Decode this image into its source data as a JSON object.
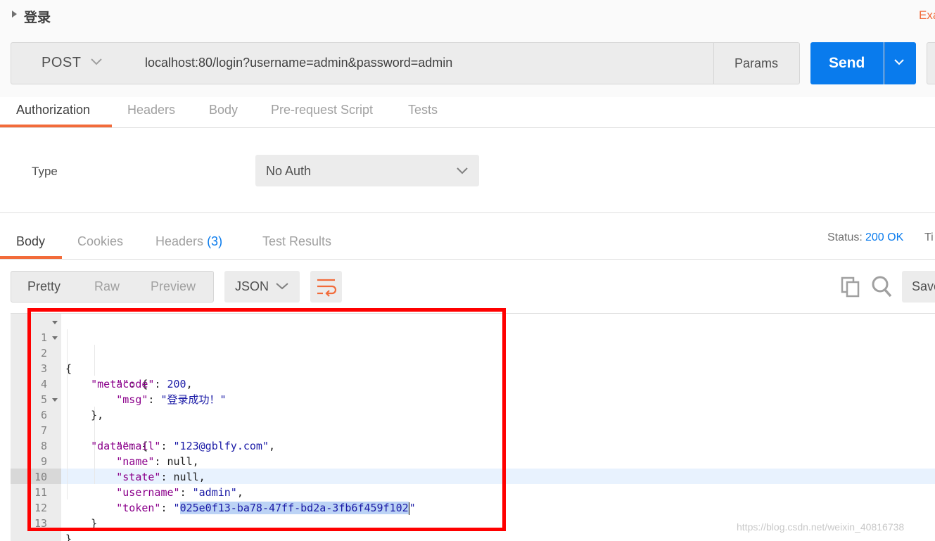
{
  "request": {
    "name": "登录",
    "examples_label": "Exa",
    "method": "POST",
    "url": "localhost:80/login?username=admin&password=admin",
    "params_label": "Params",
    "send_label": "Send"
  },
  "request_tabs": [
    "Authorization",
    "Headers",
    "Body",
    "Pre-request Script",
    "Tests"
  ],
  "auth": {
    "type_label": "Type",
    "type_value": "No Auth"
  },
  "response_tabs": {
    "body": "Body",
    "cookies": "Cookies",
    "headers": "Headers",
    "headers_count": "(3)",
    "test_results": "Test Results"
  },
  "status": {
    "label": "Status:",
    "value": "200 OK",
    "time_label": "Ti"
  },
  "view_options": [
    "Pretty",
    "Raw",
    "Preview"
  ],
  "format": "JSON",
  "save_label": "Save",
  "code": {
    "line_numbers": [
      "1",
      "2",
      "3",
      "4",
      "5",
      "6",
      "7",
      "8",
      "9",
      "10",
      "11",
      "12",
      "13"
    ],
    "meta_key": "\"meta\"",
    "code_key": "\"code\"",
    "code_value": "200",
    "msg_key": "\"msg\"",
    "msg_value": "\"登录成功！\"",
    "data_key": "\"data\"",
    "email_key": "\"email\"",
    "email_value": "\"123@gblfy.com\"",
    "name_key": "\"name\"",
    "name_value": "null",
    "state_key": "\"state\"",
    "state_value": "null",
    "username_key": "\"username\"",
    "username_value": "\"admin\"",
    "token_key": "\"token\"",
    "token_value": "025e0f13-ba78-47ff-bd2a-3fb6f459f102"
  },
  "watermark": "https://blog.csdn.net/weixin_40816738",
  "colors": {
    "accent": "#f26b3a",
    "send": "#097bed",
    "highlight_box": "#ff0000"
  }
}
